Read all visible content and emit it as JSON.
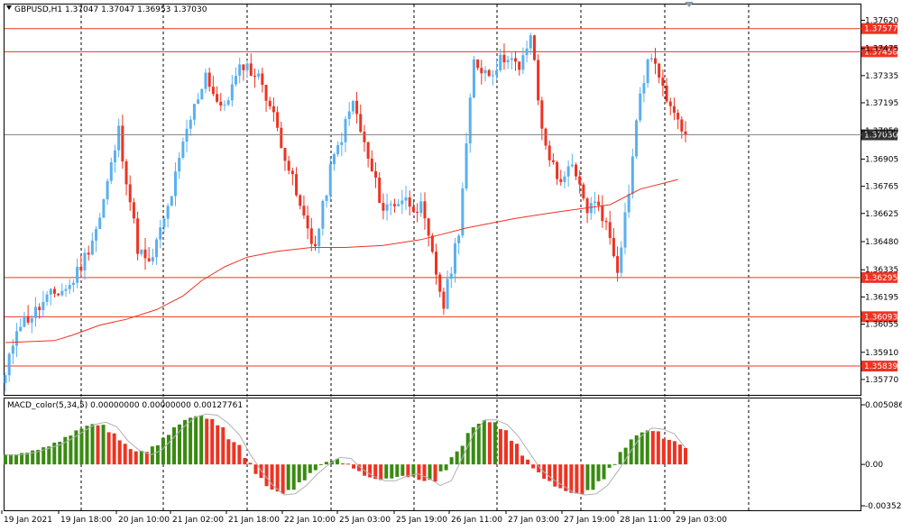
{
  "header": {
    "symbol_title": "GBPUSD,H1  1.37047 1.37047 1.36953 1.37030"
  },
  "macd": {
    "title": "MACD_color(5,34,5) 0.00000000 0.00000000 0.00127761"
  },
  "colors": {
    "bull": "#5ab0ee",
    "bear": "#ee3322",
    "level_line": "#ee3322",
    "ma_line": "#ee3322",
    "macd_pos": "#3a8a12",
    "macd_neg": "#ee3322",
    "signal": "#b0b0b0",
    "current_line": "#888888"
  },
  "chart_data": [
    {
      "type": "candlestick",
      "symbol": "GBPUSD",
      "timeframe": "H1",
      "ohlc_current": {
        "open": 1.37047,
        "high": 1.37047,
        "low": 1.36953,
        "close": 1.3703
      },
      "ylim": [
        1.357,
        1.3765
      ],
      "y_ticks": [
        "1.37620",
        "1.37475",
        "1.37335",
        "1.37195",
        "1.37050",
        "1.36905",
        "1.36765",
        "1.36625",
        "1.36480",
        "1.36335",
        "1.36195",
        "1.36055",
        "1.35910",
        "1.35770"
      ],
      "x_ticks": [
        "19 Jan 2021",
        "19 Jan 18:00",
        "20 Jan 10:00",
        "21 Jan 02:00",
        "21 Jan 18:00",
        "22 Jan 10:00",
        "25 Jan 03:00",
        "25 Jan 19:00",
        "26 Jan 11:00",
        "27 Jan 03:00",
        "27 Jan 19:00",
        "28 Jan 11:00",
        "29 Jan 03:00"
      ],
      "current_price": {
        "value": 1.3703,
        "label": "1.37030"
      },
      "levels": [
        {
          "value": 1.37577,
          "label": "1.37577"
        },
        {
          "value": 1.37458,
          "label": "1.37458"
        },
        {
          "value": 1.36295,
          "label": "1.36295"
        },
        {
          "value": 1.36093,
          "label": "1.36093"
        },
        {
          "value": 1.35839,
          "label": "1.35839"
        }
      ],
      "moving_average_path": [
        [
          0,
          1.3596
        ],
        [
          13,
          1.3597
        ],
        [
          18,
          1.36
        ],
        [
          25,
          1.3605
        ],
        [
          32,
          1.3608
        ],
        [
          40,
          1.3613
        ],
        [
          47,
          1.362
        ],
        [
          52,
          1.3628
        ],
        [
          58,
          1.3635
        ],
        [
          64,
          1.364
        ],
        [
          72,
          1.3643
        ],
        [
          81,
          1.3645
        ],
        [
          90,
          1.3645
        ],
        [
          100,
          1.3646
        ],
        [
          110,
          1.3649
        ],
        [
          122,
          1.3655
        ],
        [
          135,
          1.366
        ],
        [
          145,
          1.3663
        ],
        [
          160,
          1.3667
        ],
        [
          168,
          1.3675
        ],
        [
          178,
          1.368
        ]
      ],
      "price_path": [
        [
          0,
          1.3578
        ],
        [
          3,
          1.3605
        ],
        [
          7,
          1.361
        ],
        [
          12,
          1.362
        ],
        [
          17,
          1.3625
        ],
        [
          21,
          1.364
        ],
        [
          25,
          1.366
        ],
        [
          30,
          1.3705
        ],
        [
          35,
          1.3645
        ],
        [
          38,
          1.3635
        ],
        [
          43,
          1.3665
        ],
        [
          48,
          1.3705
        ],
        [
          53,
          1.3735
        ],
        [
          57,
          1.3715
        ],
        [
          63,
          1.374
        ],
        [
          68,
          1.373
        ],
        [
          73,
          1.37
        ],
        [
          78,
          1.3665
        ],
        [
          82,
          1.3645
        ],
        [
          86,
          1.3685
        ],
        [
          92,
          1.372
        ],
        [
          96,
          1.369
        ],
        [
          100,
          1.3665
        ],
        [
          105,
          1.367
        ],
        [
          110,
          1.3665
        ],
        [
          113,
          1.364
        ],
        [
          116,
          1.3615
        ],
        [
          120,
          1.3655
        ],
        [
          124,
          1.374
        ],
        [
          128,
          1.3735
        ],
        [
          133,
          1.3745
        ],
        [
          136,
          1.3735
        ],
        [
          139,
          1.3755
        ],
        [
          142,
          1.3705
        ],
        [
          146,
          1.368
        ],
        [
          150,
          1.3685
        ],
        [
          154,
          1.3665
        ],
        [
          157,
          1.3668
        ],
        [
          160,
          1.365
        ],
        [
          162,
          1.3635
        ],
        [
          165,
          1.3675
        ],
        [
          168,
          1.3725
        ],
        [
          171,
          1.3745
        ],
        [
          174,
          1.3725
        ],
        [
          177,
          1.3718
        ],
        [
          180,
          1.3703
        ]
      ]
    },
    {
      "type": "bar",
      "name": "MACD_color(5,34,5)",
      "ylim": [
        -0.0035264,
        0.0050862
      ],
      "y_ticks": [
        "0.0050862",
        "0.00",
        "-0.0035264"
      ],
      "signal_values": [
        0.0008,
        0.0008,
        0.0009,
        0.0011,
        0.0014,
        0.0017,
        0.0022,
        0.0028,
        0.0034,
        0.0036,
        0.0032,
        0.002,
        0.0012,
        0.0008,
        0.0012,
        0.0022,
        0.0032,
        0.004,
        0.0043,
        0.0042,
        0.0035,
        0.0025,
        0.0008,
        -0.0006,
        -0.0018,
        -0.0026,
        -0.0025,
        -0.0018,
        -0.0008,
        0.0,
        0.0006,
        0.0005,
        -0.0004,
        -0.001,
        -0.0014,
        -0.0014,
        -0.001,
        -0.0008,
        -0.0012,
        -0.0018,
        -0.0014,
        0.0006,
        0.0026,
        0.0038,
        0.0038,
        0.0034,
        0.0024,
        0.001,
        -0.0004,
        -0.0012,
        -0.0018,
        -0.0024,
        -0.0026,
        -0.0025,
        -0.0018,
        -0.0005,
        0.001,
        0.0024,
        0.0031,
        0.003,
        0.0026,
        0.0014
      ]
    }
  ]
}
